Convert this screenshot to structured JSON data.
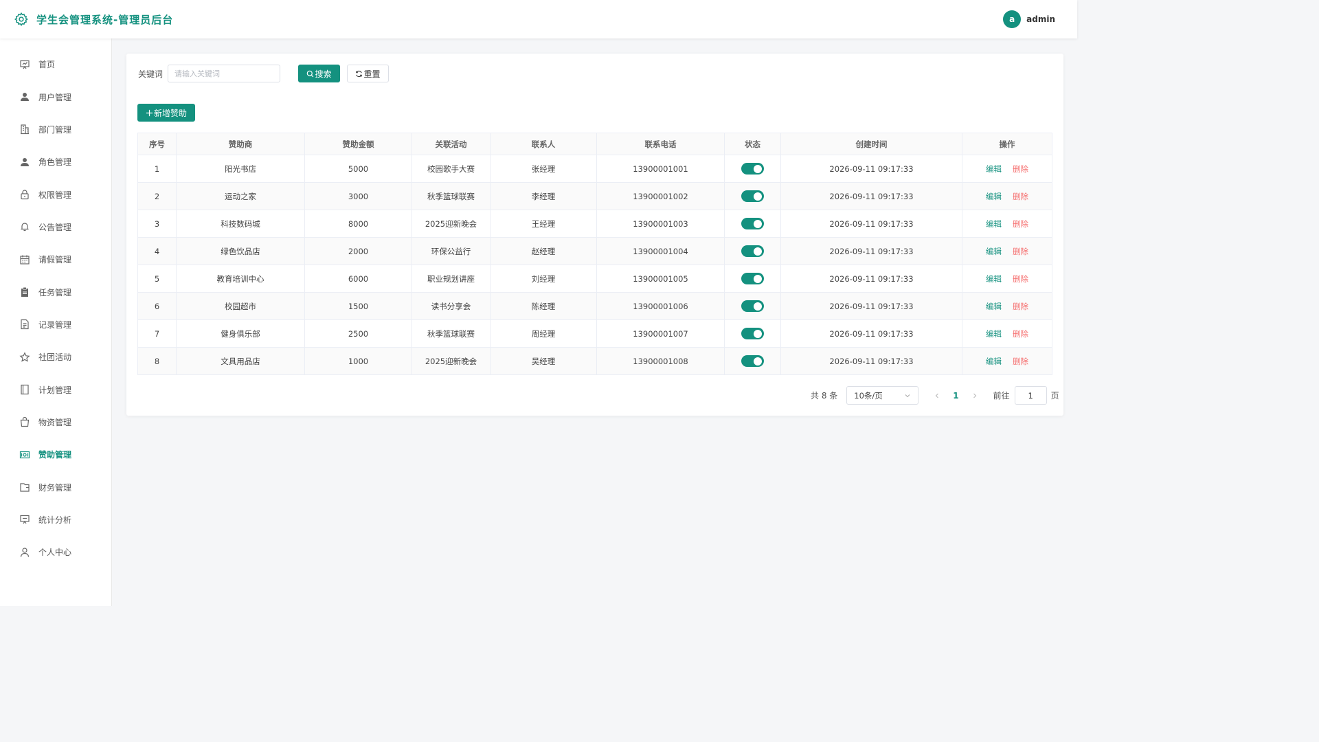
{
  "header": {
    "title": "学生会管理系统-管理员后台",
    "avatar_letter": "a",
    "username": "admin"
  },
  "sidebar": {
    "items": [
      {
        "label": "首页",
        "icon": "dashboard-icon",
        "active": false
      },
      {
        "label": "用户管理",
        "icon": "user-icon",
        "active": false
      },
      {
        "label": "部门管理",
        "icon": "building-icon",
        "active": false
      },
      {
        "label": "角色管理",
        "icon": "user-icon",
        "active": false
      },
      {
        "label": "权限管理",
        "icon": "lock-icon",
        "active": false
      },
      {
        "label": "公告管理",
        "icon": "bell-icon",
        "active": false
      },
      {
        "label": "请假管理",
        "icon": "calendar-icon",
        "active": false
      },
      {
        "label": "任务管理",
        "icon": "clipboard-icon",
        "active": false
      },
      {
        "label": "记录管理",
        "icon": "document-icon",
        "active": false
      },
      {
        "label": "社团活动",
        "icon": "star-icon",
        "active": false
      },
      {
        "label": "计划管理",
        "icon": "notebook-icon",
        "active": false
      },
      {
        "label": "物资管理",
        "icon": "shopping-bag-icon",
        "active": false
      },
      {
        "label": "赞助管理",
        "icon": "money-icon",
        "active": true
      },
      {
        "label": "财务管理",
        "icon": "wallet-icon",
        "active": false
      },
      {
        "label": "统计分析",
        "icon": "presentation-icon",
        "active": false
      },
      {
        "label": "个人中心",
        "icon": "user-outline-icon",
        "active": false
      }
    ]
  },
  "search": {
    "keyword_label": "关键词",
    "placeholder": "请输入关键词",
    "value": "",
    "search_label": "搜索",
    "reset_label": "重置"
  },
  "add_button_label": "新增赞助",
  "table": {
    "columns": [
      "序号",
      "赞助商",
      "赞助金额",
      "关联活动",
      "联系人",
      "联系电话",
      "状态",
      "创建时间",
      "操作"
    ],
    "edit_label": "编辑",
    "delete_label": "删除",
    "rows": [
      {
        "no": "1",
        "sponsor": "阳光书店",
        "amount": "5000",
        "activity": "校园歌手大赛",
        "contact": "张经理",
        "phone": "13900001001",
        "status": true,
        "created": "2026-09-11 09:17:33"
      },
      {
        "no": "2",
        "sponsor": "运动之家",
        "amount": "3000",
        "activity": "秋季篮球联赛",
        "contact": "李经理",
        "phone": "13900001002",
        "status": true,
        "created": "2026-09-11 09:17:33"
      },
      {
        "no": "3",
        "sponsor": "科技数码城",
        "amount": "8000",
        "activity": "2025迎新晚会",
        "contact": "王经理",
        "phone": "13900001003",
        "status": true,
        "created": "2026-09-11 09:17:33"
      },
      {
        "no": "4",
        "sponsor": "绿色饮品店",
        "amount": "2000",
        "activity": "环保公益行",
        "contact": "赵经理",
        "phone": "13900001004",
        "status": true,
        "created": "2026-09-11 09:17:33"
      },
      {
        "no": "5",
        "sponsor": "教育培训中心",
        "amount": "6000",
        "activity": "职业规划讲座",
        "contact": "刘经理",
        "phone": "13900001005",
        "status": true,
        "created": "2026-09-11 09:17:33"
      },
      {
        "no": "6",
        "sponsor": "校园超市",
        "amount": "1500",
        "activity": "读书分享会",
        "contact": "陈经理",
        "phone": "13900001006",
        "status": true,
        "created": "2026-09-11 09:17:33"
      },
      {
        "no": "7",
        "sponsor": "健身俱乐部",
        "amount": "2500",
        "activity": "秋季篮球联赛",
        "contact": "周经理",
        "phone": "13900001007",
        "status": true,
        "created": "2026-09-11 09:17:33"
      },
      {
        "no": "8",
        "sponsor": "文具用品店",
        "amount": "1000",
        "activity": "2025迎新晚会",
        "contact": "吴经理",
        "phone": "13900001008",
        "status": true,
        "created": "2026-09-11 09:17:33"
      }
    ]
  },
  "pagination": {
    "total_text": "共 8 条",
    "page_size": "10条/页",
    "current_page": "1",
    "goto_label": "前往",
    "goto_value": "1",
    "page_suffix": "页"
  },
  "colors": {
    "accent": "#14917f",
    "danger": "#f56c6c"
  }
}
